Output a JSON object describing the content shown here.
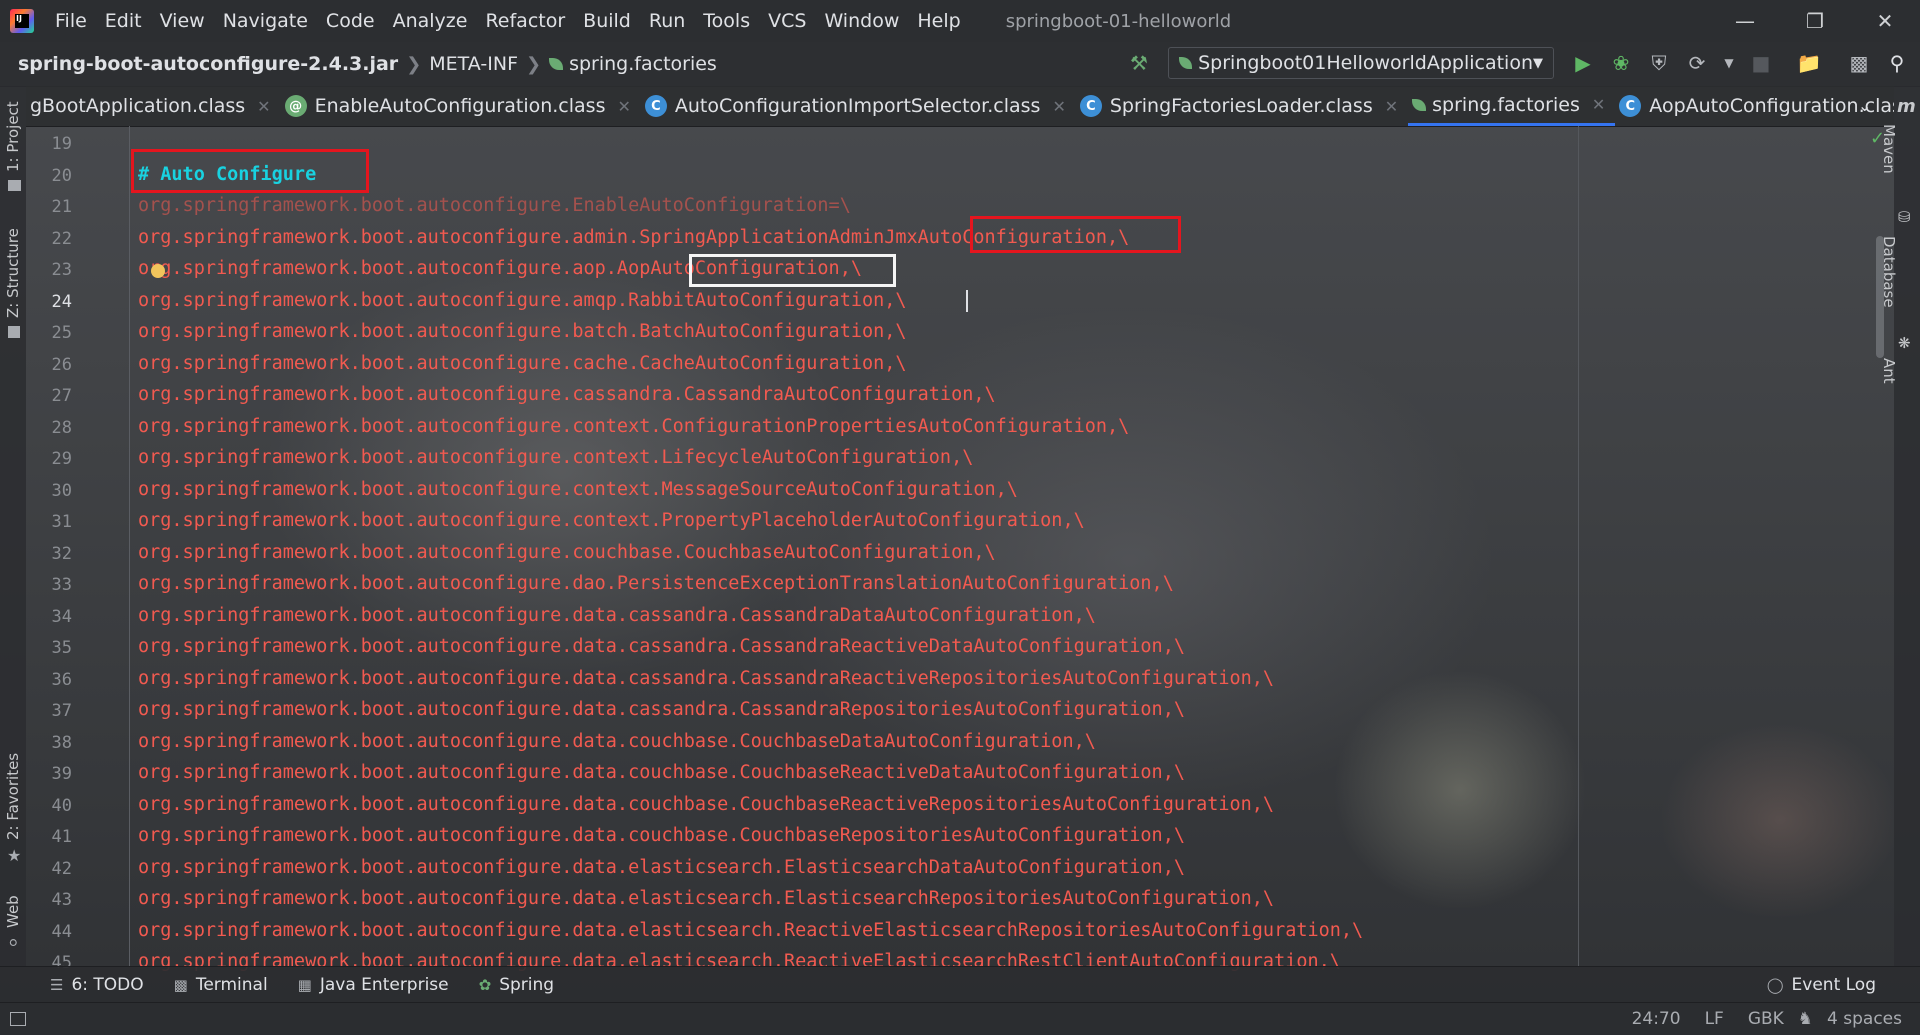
{
  "menu": {
    "items": [
      "File",
      "Edit",
      "View",
      "Navigate",
      "Code",
      "Analyze",
      "Refactor",
      "Build",
      "Run",
      "Tools",
      "VCS",
      "Window",
      "Help"
    ],
    "project_title": "springboot-01-helloworld"
  },
  "breadcrumb": {
    "jar": "spring-boot-autoconfigure-2.4.3.jar",
    "folder": "META-INF",
    "file": "spring.factories"
  },
  "run_config": "Springboot01HelloworldApplication",
  "tabs": [
    {
      "label": "gBootApplication.class",
      "icon": "class-icon",
      "active": false
    },
    {
      "label": "EnableAutoConfiguration.class",
      "icon": "annotation-icon",
      "active": false
    },
    {
      "label": "AutoConfigurationImportSelector.class",
      "icon": "class-icon",
      "active": false
    },
    {
      "label": "SpringFactoriesLoader.class",
      "icon": "class-icon",
      "active": false
    },
    {
      "label": "spring.factories",
      "icon": "spring-leaf-icon",
      "active": true
    },
    {
      "label": "AopAutoConfiguration.class",
      "icon": "class-icon",
      "active": false
    }
  ],
  "left_tool_tabs": [
    "1: Project",
    "Z: Structure",
    "2: Favorites",
    "Web"
  ],
  "right_tool_tabs": [
    "Maven",
    "Database",
    "Ant"
  ],
  "editor": {
    "current_line": "24",
    "lines": [
      {
        "n": "19",
        "text": ""
      },
      {
        "n": "20",
        "text": "# Auto Configure"
      },
      {
        "n": "21",
        "text": "org.springframework.boot.autoconfigure.EnableAutoConfiguration=\\"
      },
      {
        "n": "22",
        "text": "org.springframework.boot.autoconfigure.admin.SpringApplicationAdminJmxAutoConfiguration,\\"
      },
      {
        "n": "23",
        "text": "org.springframework.boot.autoconfigure.aop.AopAutoConfiguration,\\"
      },
      {
        "n": "24",
        "text": "org.springframework.boot.autoconfigure.amqp.RabbitAutoConfiguration,\\"
      },
      {
        "n": "25",
        "text": "org.springframework.boot.autoconfigure.batch.BatchAutoConfiguration,\\"
      },
      {
        "n": "26",
        "text": "org.springframework.boot.autoconfigure.cache.CacheAutoConfiguration,\\"
      },
      {
        "n": "27",
        "text": "org.springframework.boot.autoconfigure.cassandra.CassandraAutoConfiguration,\\"
      },
      {
        "n": "28",
        "text": "org.springframework.boot.autoconfigure.context.ConfigurationPropertiesAutoConfiguration,\\"
      },
      {
        "n": "29",
        "text": "org.springframework.boot.autoconfigure.context.LifecycleAutoConfiguration,\\"
      },
      {
        "n": "30",
        "text": "org.springframework.boot.autoconfigure.context.MessageSourceAutoConfiguration,\\"
      },
      {
        "n": "31",
        "text": "org.springframework.boot.autoconfigure.context.PropertyPlaceholderAutoConfiguration,\\"
      },
      {
        "n": "32",
        "text": "org.springframework.boot.autoconfigure.couchbase.CouchbaseAutoConfiguration,\\"
      },
      {
        "n": "33",
        "text": "org.springframework.boot.autoconfigure.dao.PersistenceExceptionTranslationAutoConfiguration,\\"
      },
      {
        "n": "34",
        "text": "org.springframework.boot.autoconfigure.data.cassandra.CassandraDataAutoConfiguration,\\"
      },
      {
        "n": "35",
        "text": "org.springframework.boot.autoconfigure.data.cassandra.CassandraReactiveDataAutoConfiguration,\\"
      },
      {
        "n": "36",
        "text": "org.springframework.boot.autoconfigure.data.cassandra.CassandraReactiveRepositoriesAutoConfiguration,\\"
      },
      {
        "n": "37",
        "text": "org.springframework.boot.autoconfigure.data.cassandra.CassandraRepositoriesAutoConfiguration,\\"
      },
      {
        "n": "38",
        "text": "org.springframework.boot.autoconfigure.data.couchbase.CouchbaseDataAutoConfiguration,\\"
      },
      {
        "n": "39",
        "text": "org.springframework.boot.autoconfigure.data.couchbase.CouchbaseReactiveDataAutoConfiguration,\\"
      },
      {
        "n": "40",
        "text": "org.springframework.boot.autoconfigure.data.couchbase.CouchbaseReactiveRepositoriesAutoConfiguration,\\"
      },
      {
        "n": "41",
        "text": "org.springframework.boot.autoconfigure.data.couchbase.CouchbaseRepositoriesAutoConfiguration,\\"
      },
      {
        "n": "42",
        "text": "org.springframework.boot.autoconfigure.data.elasticsearch.ElasticsearchDataAutoConfiguration,\\"
      },
      {
        "n": "43",
        "text": "org.springframework.boot.autoconfigure.data.elasticsearch.ElasticsearchRepositoriesAutoConfiguration,\\"
      },
      {
        "n": "44",
        "text": "org.springframework.boot.autoconfigure.data.elasticsearch.ReactiveElasticsearchRepositoriesAutoConfiguration,\\"
      },
      {
        "n": "45",
        "text": "org.springframework.boot.autoconfigure.data.elasticsearch.ReactiveElasticsearchRestClientAutoConfiguration,\\"
      }
    ]
  },
  "bottom_tools": [
    {
      "label": "6: TODO",
      "icon": "list-icon"
    },
    {
      "label": "Terminal",
      "icon": "terminal-icon"
    },
    {
      "label": "Java Enterprise",
      "icon": "java-enterprise-icon"
    },
    {
      "label": "Spring",
      "icon": "spring-leaf-icon"
    }
  ],
  "event_log": "Event Log",
  "status": {
    "position": "24:70",
    "line_separator": "LF",
    "encoding": "GBK",
    "indent": "4 spaces"
  },
  "colors": {
    "code_text": "#f25a50",
    "comment": "#19d2e0",
    "highlight_red": "#e5151e",
    "highlight_white": "#f5f5f5",
    "active_tab": "#3574f0"
  }
}
